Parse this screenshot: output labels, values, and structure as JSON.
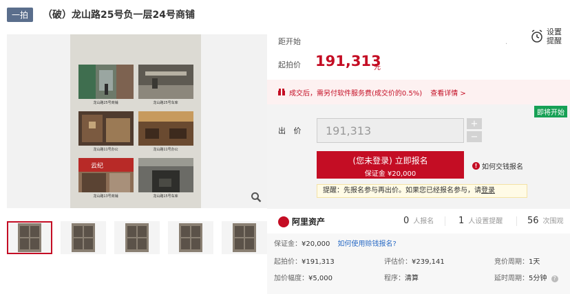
{
  "header": {
    "auction_tag": "一拍",
    "title": "（破）龙山路25号负一层24号商铺"
  },
  "gallery": {
    "captions": [
      "龙山路25号商铺",
      "龙山路25号车库",
      "龙山路11号办公",
      "龙山路11号办公",
      "龙山路13号商铺",
      "龙山路15号车库"
    ],
    "sign_text": "云纪"
  },
  "auction": {
    "countdown_label": "距开始",
    "reminder_label": "设置提醒",
    "start_price_label": "起拍价",
    "start_price": "191,313",
    "unit": "元",
    "fee_text": "成交后，需另付软件服务费(成交价的0.5%)",
    "fee_link": "查看详情 >",
    "status_badge": "即将开始",
    "bid_label": "出 价",
    "bid_value": "191,313",
    "plus": "+",
    "minus": "−",
    "register_main": "(您未登录) 立即报名",
    "register_sub": "保证金 ¥20,000",
    "how_deposit": "如何交钱报名",
    "notice_prefix": "提醒：先报名参与再出价。如果您已经报名参与，请",
    "notice_link": "登录"
  },
  "stats": {
    "brand": "阿里资产",
    "applicants": "0",
    "applicants_label": "人报名",
    "reminders": "1",
    "reminders_label": "人设置提醒",
    "views": "56",
    "views_label": "次围观"
  },
  "details": {
    "deposit_label": "保证金：",
    "deposit_value": "¥20,000",
    "deposit_link": "如何使用赊钱报名?",
    "start_label": "起拍价：",
    "start_value": "¥191,313",
    "appraisal_label": "评估价：",
    "appraisal_value": "¥239,141",
    "cycle_label": "竞价周期：",
    "cycle_value": "1天",
    "increment_label": "加价幅度：",
    "increment_value": "¥5,000",
    "procedure_label": "程序：",
    "procedure_value": "清算",
    "delay_label": "延时周期：",
    "delay_value": "5分钟"
  }
}
